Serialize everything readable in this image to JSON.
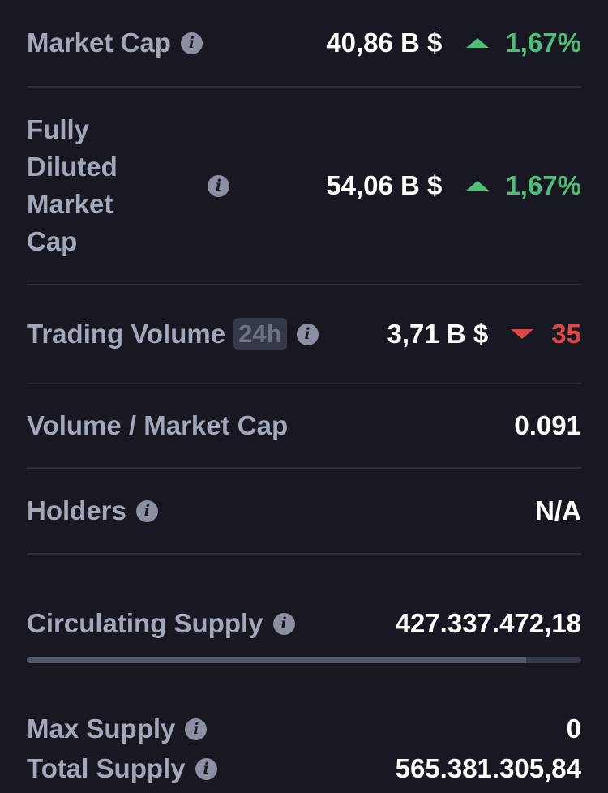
{
  "market_cap": {
    "label": "Market Cap",
    "value": "40,86 B $",
    "change": "1,67%",
    "direction": "up"
  },
  "fdv": {
    "label_lines": [
      "Fully",
      "Diluted",
      "Market",
      "Cap"
    ],
    "value": "54,06 B $",
    "change": "1,67%",
    "direction": "up"
  },
  "volume": {
    "label": "Trading Volume",
    "badge": "24h",
    "value": "3,71 B $",
    "change": "35",
    "direction": "down"
  },
  "vol_mcap": {
    "label": "Volume / Market Cap",
    "value": "0.091"
  },
  "holders": {
    "label": "Holders",
    "value": "N/A"
  },
  "circulating": {
    "label": "Circulating Supply",
    "value": "427.337.472,18",
    "progress": 0.9
  },
  "max_supply": {
    "label": "Max Supply",
    "value": "0"
  },
  "total_supply": {
    "label": "Total Supply",
    "value": "565.381.305,84"
  },
  "info_glyph": "i",
  "colors": {
    "up": "#4fbf78",
    "down": "#e04848",
    "background": "#171821"
  }
}
